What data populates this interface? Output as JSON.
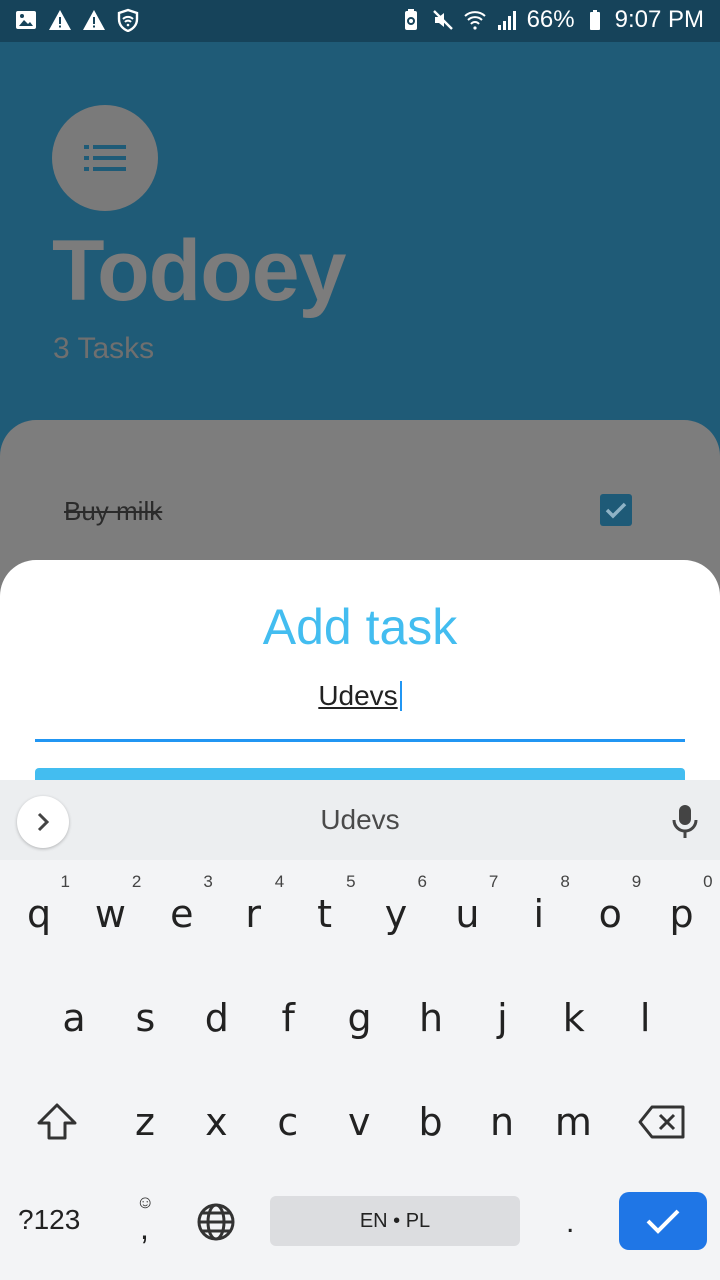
{
  "status_bar": {
    "battery": "66%",
    "time": "9:07 PM"
  },
  "app": {
    "title": "Todoey",
    "subtitle": "3 Tasks",
    "tasks": [
      {
        "label": "Buy milk",
        "checked": true
      }
    ]
  },
  "add_task_sheet": {
    "title": "Add task",
    "input_value": "Udevs"
  },
  "keyboard": {
    "suggestion": "Udevs",
    "row1": [
      {
        "ch": "q",
        "num": "1"
      },
      {
        "ch": "w",
        "num": "2"
      },
      {
        "ch": "e",
        "num": "3"
      },
      {
        "ch": "r",
        "num": "4"
      },
      {
        "ch": "t",
        "num": "5"
      },
      {
        "ch": "y",
        "num": "6"
      },
      {
        "ch": "u",
        "num": "7"
      },
      {
        "ch": "i",
        "num": "8"
      },
      {
        "ch": "o",
        "num": "9"
      },
      {
        "ch": "p",
        "num": "0"
      }
    ],
    "row2": [
      "a",
      "s",
      "d",
      "f",
      "g",
      "h",
      "j",
      "k",
      "l"
    ],
    "row3": [
      "z",
      "x",
      "c",
      "v",
      "b",
      "n",
      "m"
    ],
    "symbols_label": "?123",
    "comma": ",",
    "emoji": "☺",
    "space_label": "EN • PL",
    "period": ".",
    "accent_color": "#1f76e6"
  }
}
